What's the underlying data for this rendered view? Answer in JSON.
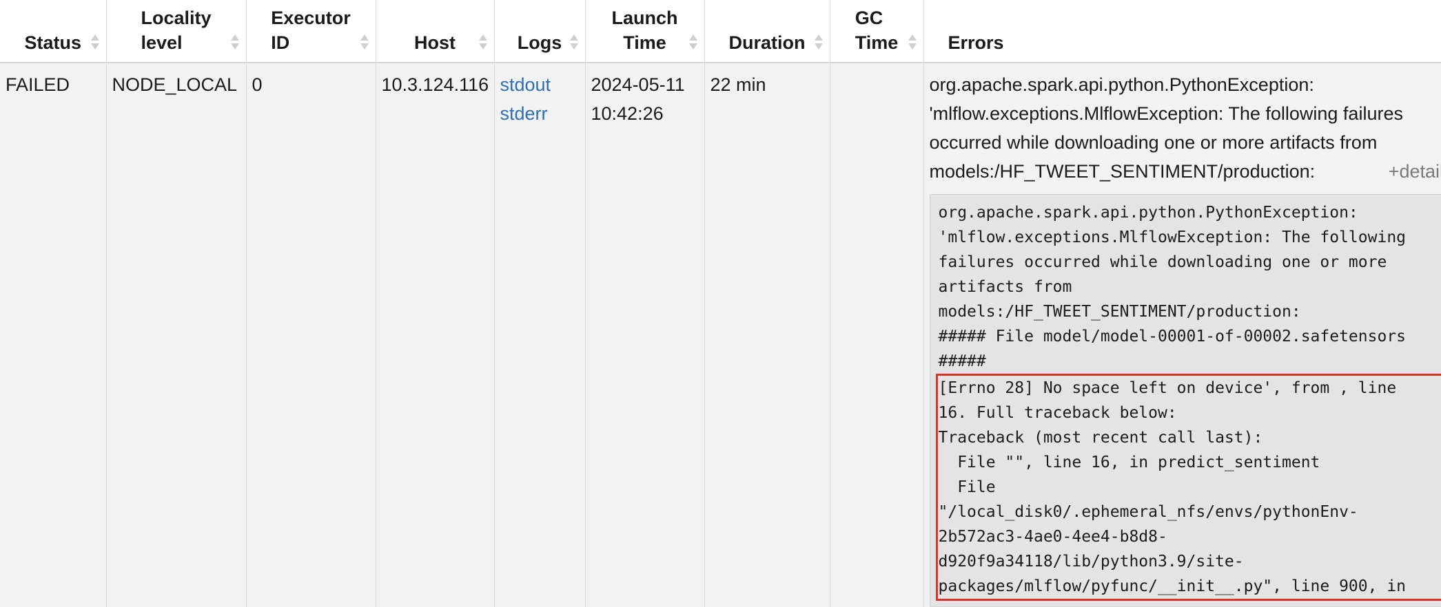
{
  "columns": [
    {
      "key": "status",
      "label": "Status"
    },
    {
      "key": "locality",
      "label": "Locality\nlevel"
    },
    {
      "key": "executor",
      "label": "Executor\nID"
    },
    {
      "key": "host",
      "label": "Host"
    },
    {
      "key": "logs",
      "label": "Logs"
    },
    {
      "key": "launch",
      "label": "Launch\nTime"
    },
    {
      "key": "duration",
      "label": "Duration"
    },
    {
      "key": "gc",
      "label": "GC\nTime"
    },
    {
      "key": "errors",
      "label": "Errors"
    }
  ],
  "row": {
    "status": "FAILED",
    "locality": "NODE_LOCAL",
    "executor_id": "0",
    "host": "10.3.124.116",
    "logs": [
      "stdout",
      "stderr"
    ],
    "launch_time": "2024-05-11\n10:42:26",
    "duration": "22 min",
    "gc_time": "",
    "error_summary": "org.apache.spark.api.python.PythonException: 'mlflow.exceptions.MlflowException: The following failures occurred while downloading one or more artifacts from models:/HF_TWEET_SENTIMENT/production:",
    "details_link": "+details",
    "trace_head": "org.apache.spark.api.python.PythonException:\n'mlflow.exceptions.MlflowException: The following\nfailures occurred while downloading one or more\nartifacts from\nmodels:/HF_TWEET_SENTIMENT/production:\n##### File model/model-00001-of-00002.safetensors\n#####",
    "trace_highlight": "[Errno 28] No space left on device', from , line\n16. Full traceback below:\nTraceback (most recent call last):\n  File \"\", line 16, in predict_sentiment\n  File\n\"/local_disk0/.ephemeral_nfs/envs/pythonEnv-\n2b572ac3-4ae0-4ee4-b8d8-\nd920f9a34118/lib/python3.9/site-\npackages/mlflow/pyfunc/__init__.py\", line 900, in"
  },
  "colors": {
    "highlight_border": "#d9362b",
    "link": "#2f6fb0",
    "row_bg": "#f2f2f2"
  }
}
